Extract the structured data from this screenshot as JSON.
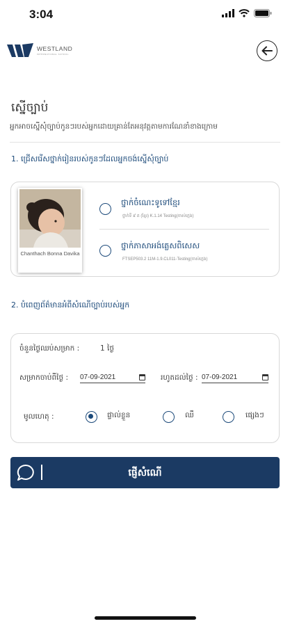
{
  "status_bar": {
    "time": "3:04"
  },
  "brand": {
    "name": "WESTLAND",
    "tagline": "INTERNATIONAL SCHOOL"
  },
  "page": {
    "title": "ស្នើច្បាប់",
    "subtitle": "អ្នកអាចស្នើសុំច្បាប់កូនៗរបស់អ្នកដោយគ្រាន់តែអនុវត្តតាមការណែនាំខាងក្រោម"
  },
  "section1": {
    "label": "1. ជ្រើសរើសថ្នាក់រៀនរបស់កូនៗដែលអ្នកចង់ស្នើសុំច្បាប់"
  },
  "student": {
    "name": "Chanthach Bonna Davika"
  },
  "courses": [
    {
      "name": "ថ្នាក់ចំណេះទូទៅខ្មែរ",
      "detail": "ថ្នាក់ទី ៩ គ (ខ្មែរ) K.1.14 Testing(ចាស់ក្មេង)",
      "selected": false
    },
    {
      "name": "ថ្នាក់ភាសាអង់គ្លេសពិសេស",
      "detail": "FTSEP503.2 11M-1.9.CL011-Testing(ចាស់ក្មេង)",
      "selected": false
    }
  ],
  "section2": {
    "label": "2. បំពេញព័ត៌មានអំពីសំណើច្បាប់របស់អ្នក"
  },
  "form": {
    "days_label": "ចំនួនថ្ងៃឈប់សម្រាក :",
    "days_value": "1 ថ្ងៃ",
    "from_label": "សម្រាកចាប់ពីថ្ងៃ :",
    "from_date": "07-09-2021",
    "to_label": "រហូតដល់ថ្ងៃ :",
    "to_date": "07-09-2021",
    "reason_label": "មូលហេតុ :",
    "reasons": [
      {
        "label": "ផ្ទាល់ខ្លួន",
        "selected": true
      },
      {
        "label": "ឈឺ",
        "selected": false
      },
      {
        "label": "ផ្សេងៗ",
        "selected": false
      }
    ]
  },
  "submit": {
    "label": "ផ្ញើសំណើ"
  },
  "colors": {
    "primary": "#1b3a63",
    "accent": "#1c4a7a",
    "border": "#d8d8d8"
  }
}
